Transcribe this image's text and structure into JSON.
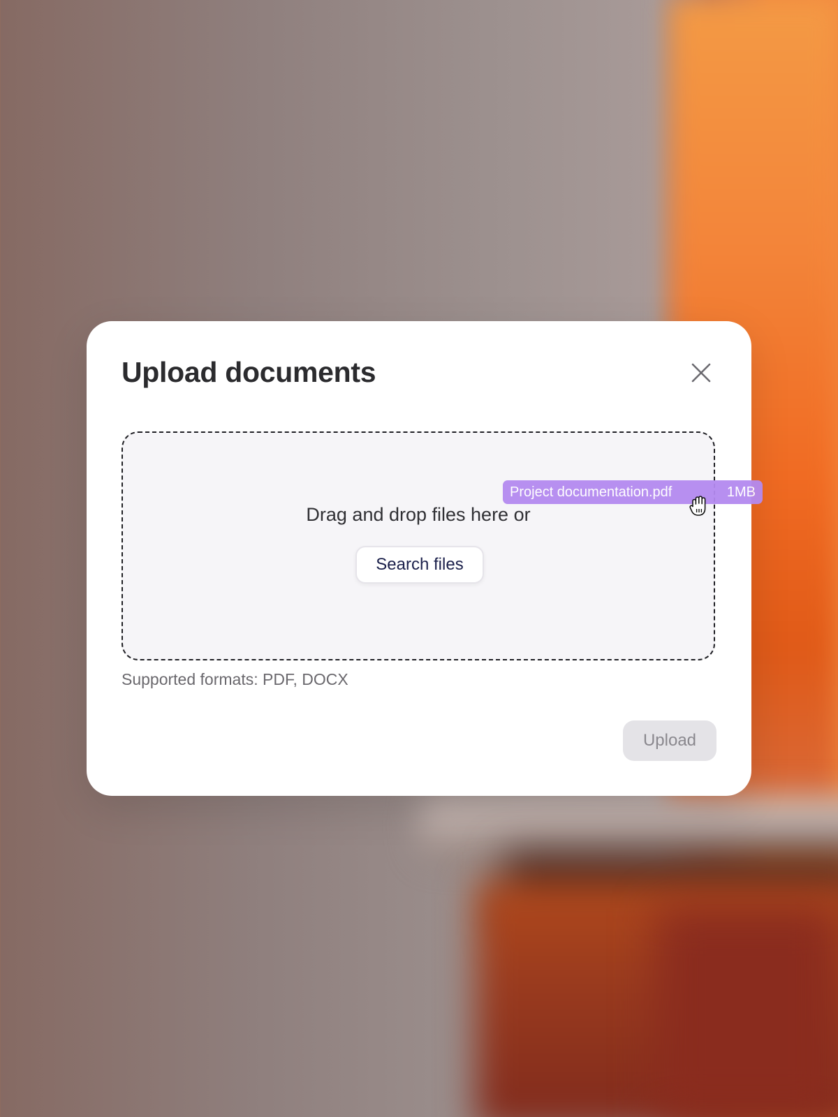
{
  "modal": {
    "title": "Upload documents",
    "dropzone": {
      "instruction": "Drag and drop files here or",
      "search_button_label": "Search files"
    },
    "supported_formats": "Supported formats: PDF, DOCX",
    "upload_button_label": "Upload"
  },
  "dragged_file": {
    "name": "Project documentation.pdf",
    "size": "1MB"
  },
  "colors": {
    "drag_chip": "#b48af0",
    "upload_disabled_bg": "#e4e3e7",
    "search_button_text": "#1a1f4a"
  },
  "icons": {
    "close": "close-icon",
    "cursor": "grab-hand-cursor-icon"
  }
}
